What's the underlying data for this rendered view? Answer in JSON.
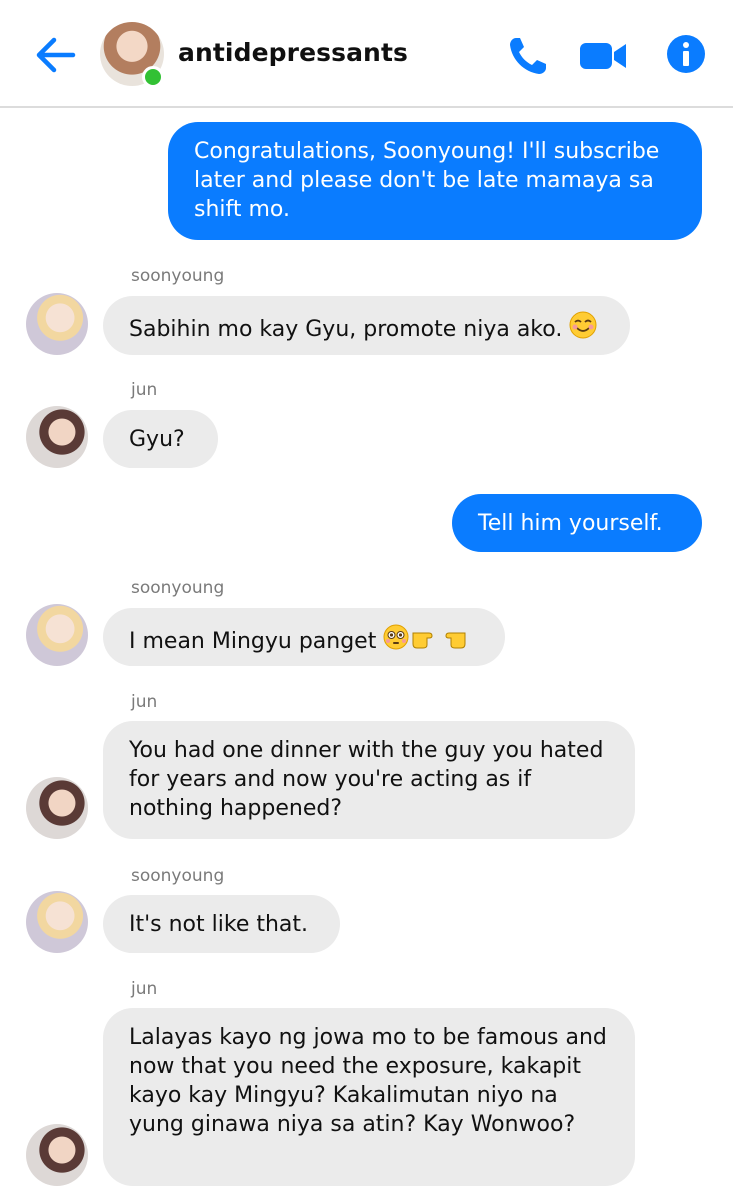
{
  "header": {
    "title": "antidepressants",
    "icons": [
      "back-arrow-icon",
      "phone-icon",
      "video-camera-icon",
      "info-icon"
    ],
    "accent_color": "#0a7cff",
    "online_color": "#32c134"
  },
  "messages": [
    {
      "direction": "outgoing",
      "text": "Congratulations, Soonyoung! I'll subscribe later and please don't be late mamaya sa shift mo."
    },
    {
      "direction": "incoming",
      "sender": "soonyoung",
      "text": "Sabihin mo kay Gyu, promote niya ako.",
      "emoji": "smiling-blush-emoji"
    },
    {
      "direction": "incoming",
      "sender": "jun",
      "text": "Gyu?"
    },
    {
      "direction": "outgoing",
      "text": "Tell him yourself."
    },
    {
      "direction": "incoming",
      "sender": "soonyoung",
      "text": "I mean Mingyu panget",
      "emoji": "flushed-face-and-two-pointing-fingers-emoji"
    },
    {
      "direction": "incoming",
      "sender": "jun",
      "text": "You had one dinner with the guy you hated for years and now you're acting as if nothing happened?"
    },
    {
      "direction": "incoming",
      "sender": "soonyoung",
      "text": "It's not like that."
    },
    {
      "direction": "incoming",
      "sender": "jun",
      "text": "Lalayas kayo ng jowa mo to be famous and now that you need the exposure, kakapit kayo kay Mingyu? Kakalimutan niyo na yung ginawa niya sa atin? Kay Wonwoo?"
    }
  ]
}
